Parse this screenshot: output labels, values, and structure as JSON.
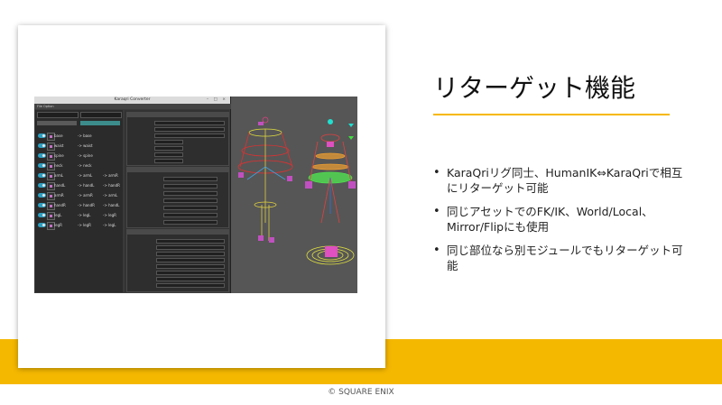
{
  "slide": {
    "title": "リターゲット機能",
    "bullets": [
      "KaraQriリグ同士、HumanIK⇔KaraQriで相互にリターゲット可能",
      "同じアセットでのFK/IK、World/Local、Mirror/Flipにも使用",
      "同じ部位なら別モジュールでもリターゲット可能"
    ],
    "copyright": "© SQUARE ENIX",
    "accent_color": "#f5b800"
  },
  "screenshot": {
    "window_title": "Karaqri Converter",
    "window_controls": "– □ ×",
    "menu": "File  Option",
    "rows": [
      {
        "a": "base",
        "b": "-> base",
        "c": ""
      },
      {
        "a": "waist",
        "b": "-> waist",
        "c": ""
      },
      {
        "a": "spine",
        "b": "-> spine",
        "c": ""
      },
      {
        "a": "neck",
        "b": "-> neck",
        "c": ""
      },
      {
        "a": "armL",
        "b": "-> armL",
        "c": "-> armR"
      },
      {
        "a": "handL",
        "b": "-> handL",
        "c": "-> handR"
      },
      {
        "a": "armR",
        "b": "-> armR",
        "c": "-> armL"
      },
      {
        "a": "handR",
        "b": "-> handR",
        "c": "-> handL"
      },
      {
        "a": "legL",
        "b": "-> legL",
        "c": "-> legR"
      },
      {
        "a": "legR",
        "b": "-> legR",
        "c": "-> legL"
      }
    ]
  }
}
